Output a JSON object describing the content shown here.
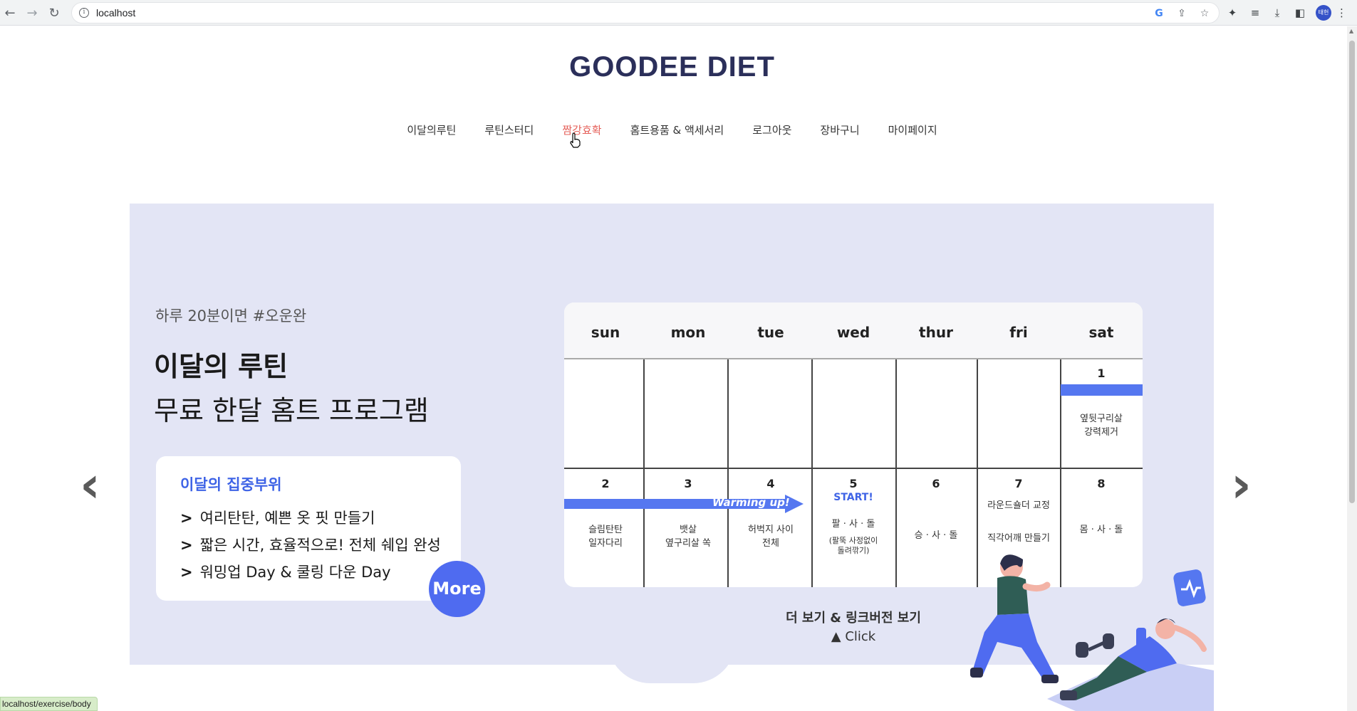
{
  "browser": {
    "url": "localhost",
    "status_url": "localhost/exercise/body",
    "avatar_label": "태헌"
  },
  "site": {
    "logo": "GOODEE DIET",
    "nav": [
      {
        "label": "이달의루틴"
      },
      {
        "label": "루틴스터디"
      },
      {
        "label": "짬강효확"
      },
      {
        "label": "홈트용품 & 액세서리"
      },
      {
        "label": "로그아웃"
      },
      {
        "label": "장바구니"
      },
      {
        "label": "마이페이지"
      }
    ],
    "active_nav_color": "#e5605a"
  },
  "banner": {
    "sub_copy": "하루 20분이면 #오운완",
    "title_strong": "이달의 루틴",
    "title_normal": "무료 한달 홈트 프로그램",
    "focus_head": "이달의 집중부위",
    "focus_items": [
      "여리탄탄, 예쁜 옷 핏 만들기",
      "짧은 시간, 효율적으로! 전체 쉐입 완성",
      "워밍업 Day & 쿨링 다운 Day"
    ],
    "more_label": "More",
    "more_link_line1": "더 보기 & 링크버전 보기",
    "more_link_line2": "▲ Click",
    "prev_arrow": "‹",
    "next_arrow": "›",
    "accent_color": "#4f6bf0",
    "background_color": "#e3e5f5"
  },
  "calendar": {
    "weekdays": [
      "sun",
      "mon",
      "tue",
      "wed",
      "thur",
      "fri",
      "sat"
    ],
    "week1": {
      "day": "1",
      "text_line1": "옆뒷구리살",
      "text_line2": "강력제거"
    },
    "week2": {
      "days": [
        "2",
        "3",
        "4",
        "5",
        "6",
        "7",
        "8"
      ],
      "warming": "Warming up!",
      "start": "START!",
      "sun_line1": "슬림탄탄",
      "sun_line2": "일자다리",
      "mon_line1": "뱃살",
      "mon_line2": "옆구리살 쏙",
      "tue_line1": "허벅지 사이",
      "tue_line2": "전체",
      "wed_line1": "팔 · 사 · 돌",
      "wed_line2": "(팔뚝 사정없이",
      "wed_line3": "돌려깎기)",
      "thu_line1": "승 · 사 · 돌",
      "fri_line1": "라운드숄더 교정",
      "fri_line2": "직각어깨 만들기",
      "sat_line1": "몸 · 사 · 돌"
    }
  }
}
